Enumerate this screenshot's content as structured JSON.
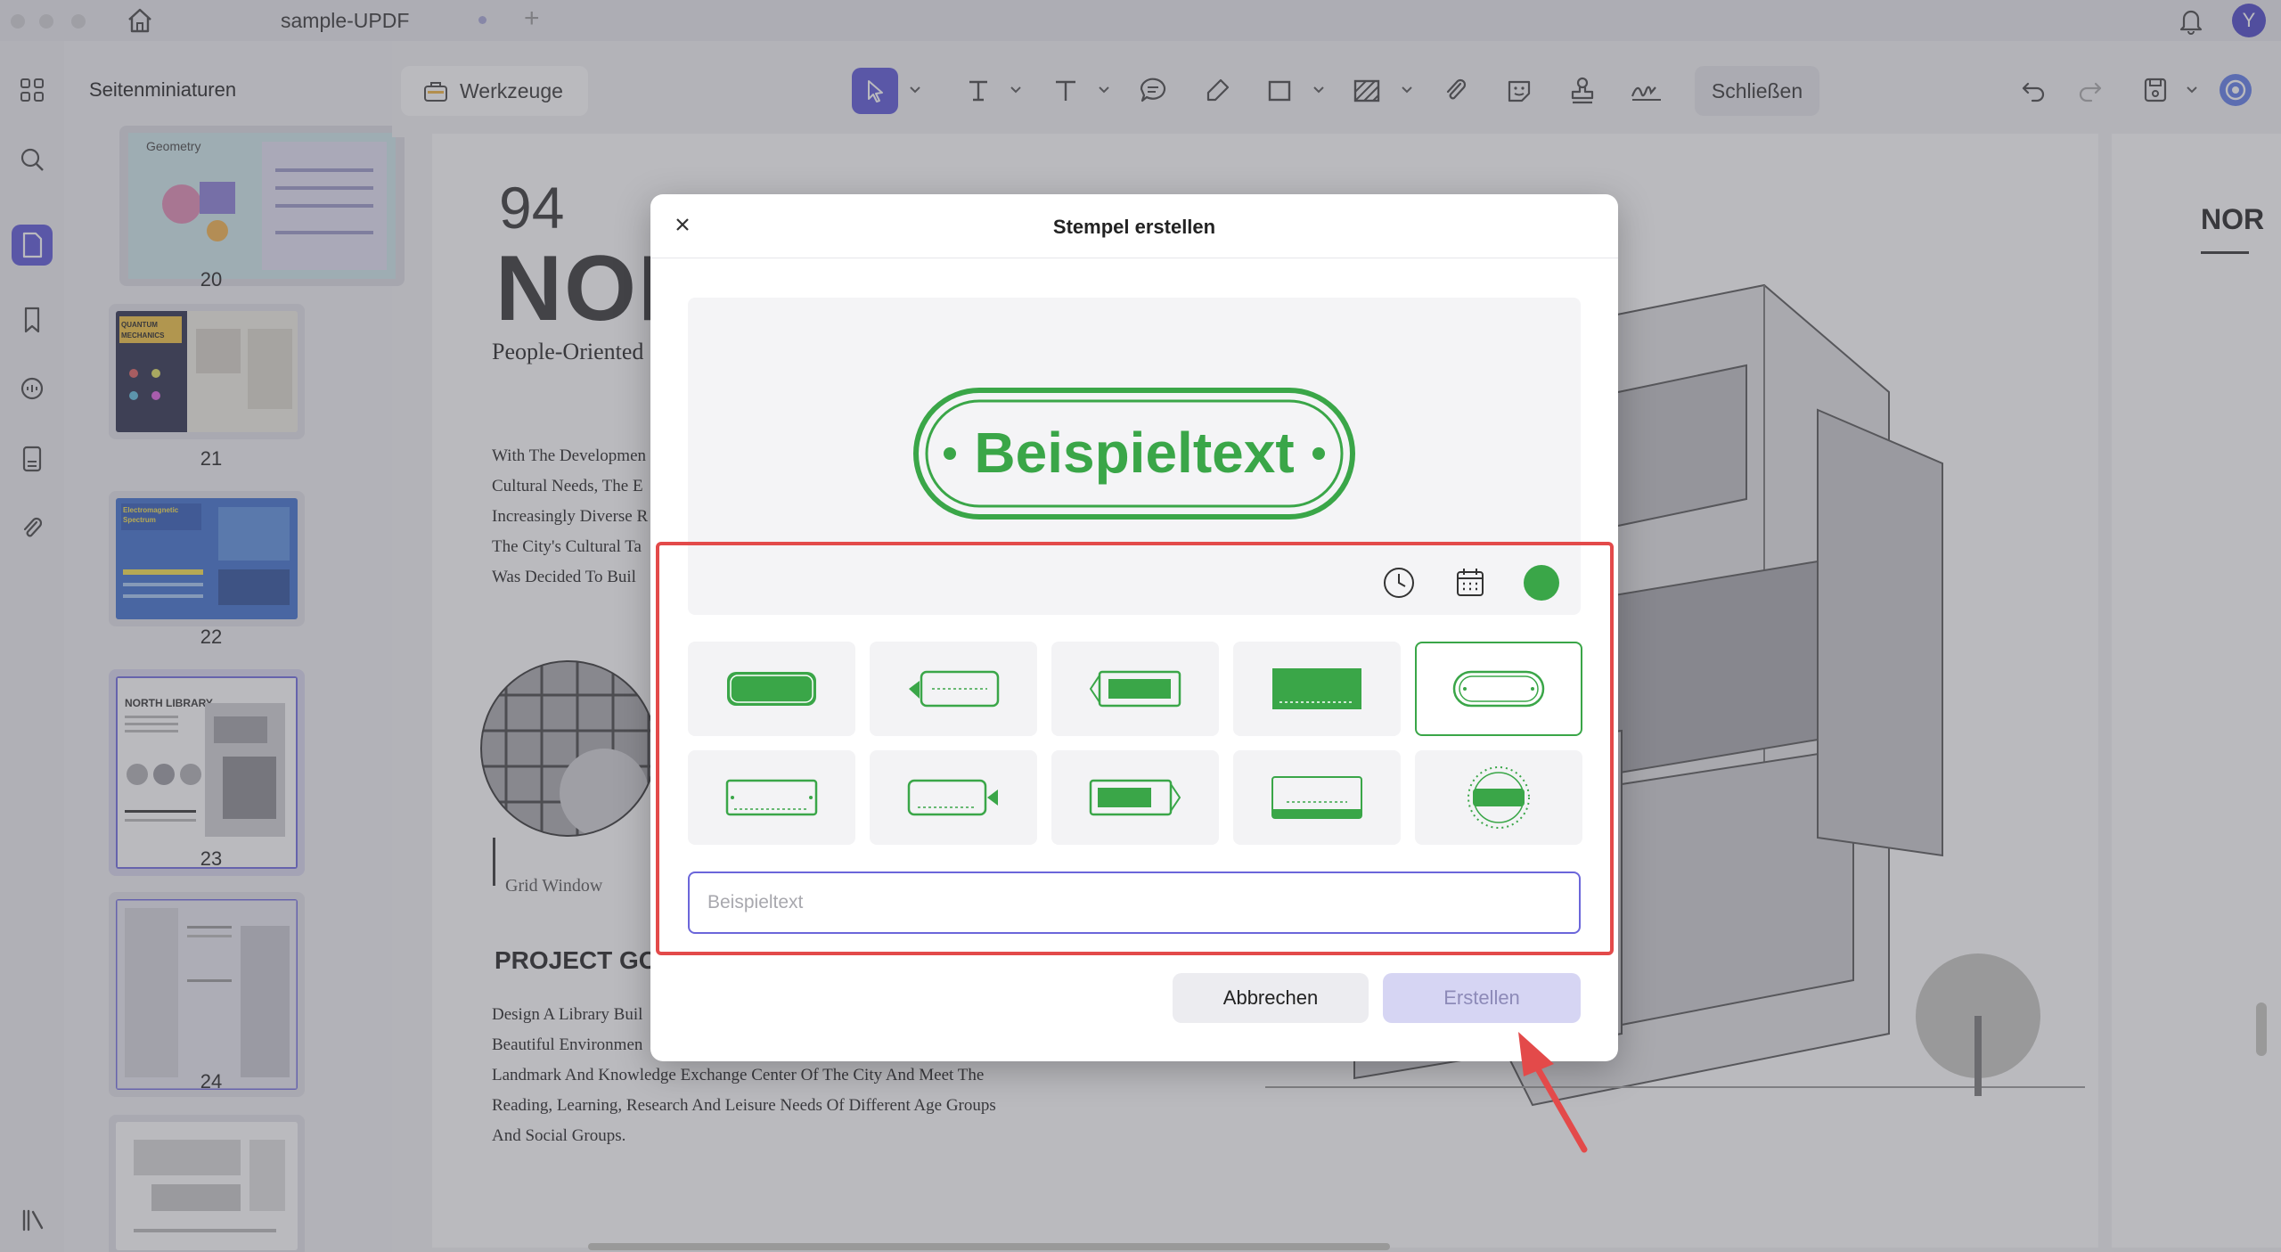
{
  "window": {
    "tab_title": "sample-UPDF",
    "avatar_initial": "Y"
  },
  "sidebar": {
    "title": "Seitenminiaturen",
    "pages": [
      {
        "number": "20",
        "label": "Geometry"
      },
      {
        "number": "21",
        "label": "QUANTUM MECHANICS"
      },
      {
        "number": "22",
        "label": "Electromagnetic Spectrum"
      },
      {
        "number": "23",
        "label": "NORTH LIBRARY"
      },
      {
        "number": "24",
        "label": ""
      }
    ],
    "selected_page": "23"
  },
  "toolbar": {
    "tools_label": "Werkzeuge",
    "close_label": "Schließen"
  },
  "document": {
    "page_number": "94",
    "heading": "NOR",
    "subtitle": "People-Oriented",
    "para1": [
      "With The Developmen",
      "Cultural Needs, The E",
      "Increasingly Diverse R",
      "The City's Cultural Ta",
      "Was Decided To Buil"
    ],
    "caption": "Grid Window",
    "section_heading": "PROJECT GO",
    "para2": [
      "Design A Library Buil",
      "Beautiful Environmen",
      "Landmark And Knowledge Exchange Center Of The City And Meet The",
      "Reading, Learning, Research And Leisure Needs Of Different Age Groups",
      "And Social Groups."
    ],
    "right_page_heading": "NOR"
  },
  "dialog": {
    "title": "Stempel erstellen",
    "stamp_preview_text": "Beispieltext",
    "stamp_color": "#3aa648",
    "input_placeholder": "Beispieltext",
    "cancel_label": "Abbrechen",
    "create_label": "Erstellen",
    "selected_style_index": 4,
    "style_count": 10
  },
  "colors": {
    "accent": "#5b55d8",
    "highlight": "#e34a4a",
    "stamp_green": "#3aa648"
  }
}
